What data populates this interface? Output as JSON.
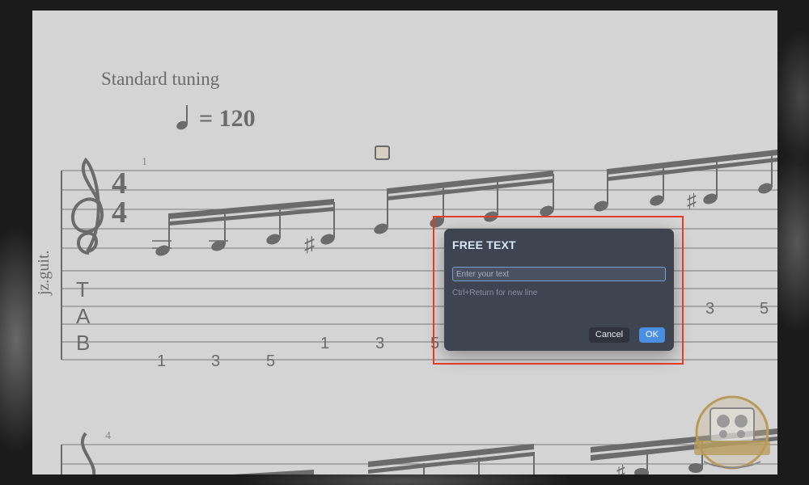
{
  "score": {
    "tuning": "Standard tuning",
    "tempo": "= 120",
    "measure_numbers": [
      "1",
      "4"
    ],
    "instrument": "jz.guit.",
    "time_signature": {
      "top": "4",
      "bottom": "4"
    },
    "tab_clef": [
      "T",
      "A",
      "B"
    ],
    "tab_numbers": [
      "1",
      "3",
      "5",
      "1",
      "3",
      "5",
      "3",
      "5"
    ]
  },
  "dialog": {
    "title": "FREE TEXT",
    "input_placeholder": "Enter your text",
    "input_value": "",
    "hint": "Ctrl+Return for new line",
    "cancel_label": "Cancel",
    "ok_label": "OK"
  },
  "colors": {
    "sheet": "#d4d4d4",
    "ink": "#6b6b6b",
    "dialog_bg": "#3e4450",
    "ok_button": "#4a90e2",
    "highlight": "#e53a25"
  },
  "logo": {
    "icon": "speaker-badge-logo"
  }
}
